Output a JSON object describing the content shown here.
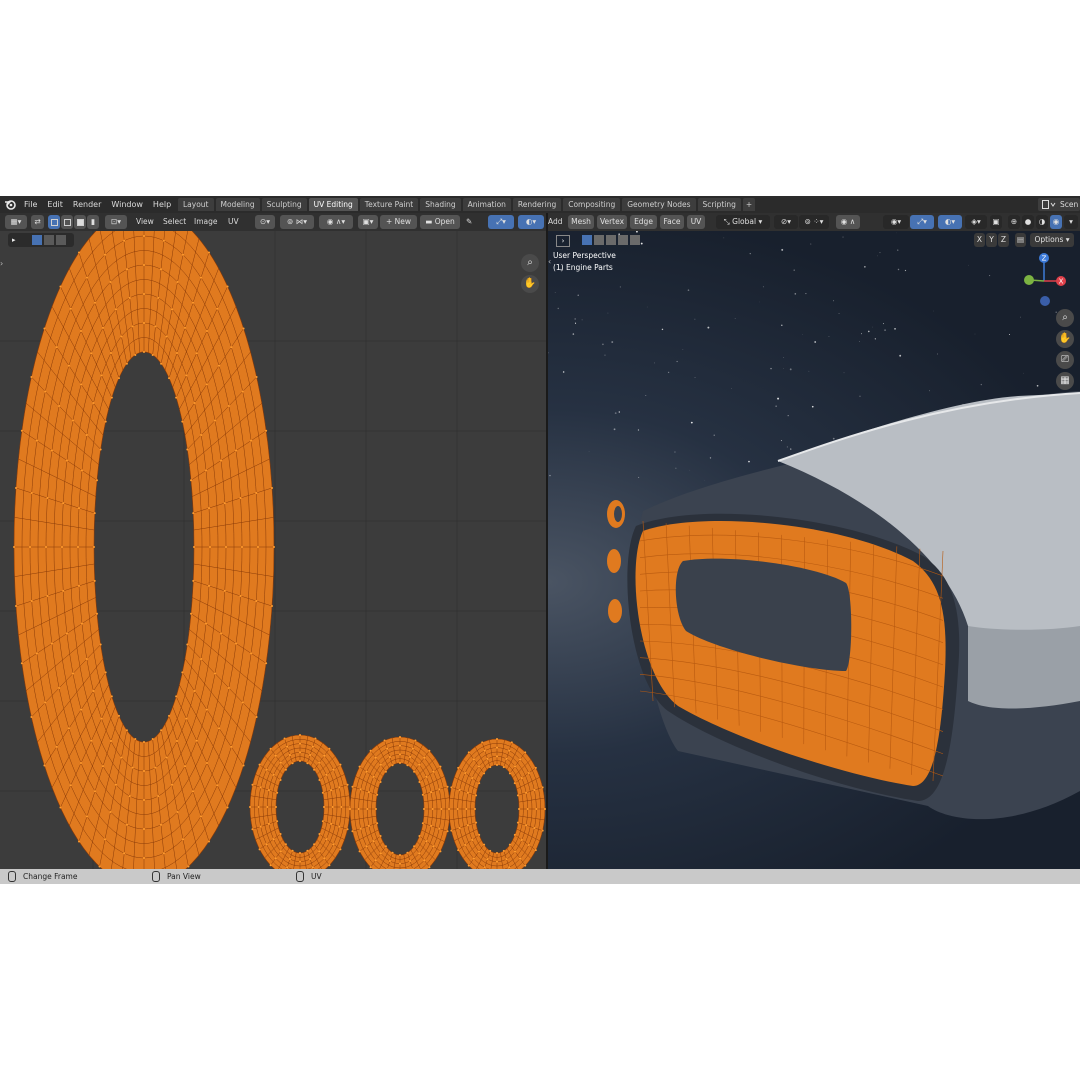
{
  "menubar": {
    "items": [
      "File",
      "Edit",
      "Render",
      "Window",
      "Help"
    ],
    "workspaces": [
      "Layout",
      "Modeling",
      "Sculpting",
      "UV Editing",
      "Texture Paint",
      "Shading",
      "Animation",
      "Rendering",
      "Compositing",
      "Geometry Nodes",
      "Scripting"
    ],
    "active_workspace": "UV Editing",
    "add_tab": "+",
    "scene_label": "Scen"
  },
  "uv_editor": {
    "menus": [
      "View",
      "Select",
      "Image",
      "UV"
    ],
    "new_label": "New",
    "open_label": "Open"
  },
  "viewport": {
    "menus": [
      "Add",
      "Mesh",
      "Vertex",
      "Edge",
      "Face",
      "UV"
    ],
    "transform_orientation": "Global",
    "axes": [
      "X",
      "Y",
      "Z"
    ],
    "options_label": "Options",
    "overlay_line1": "User Perspective",
    "overlay_line2": "(1) Engine Parts",
    "gizmo": {
      "z": "Z",
      "x": "X"
    }
  },
  "statusbar": {
    "items": [
      "Change Frame",
      "Pan View",
      "UV"
    ]
  },
  "colors": {
    "uv_face": "#e07a1f",
    "uv_edge": "#8a3a08",
    "uv_vertex": "#ff9b2e",
    "active_tab": "#545454",
    "header": "#303030",
    "uv_background": "#3c3c3c",
    "space_background": "#1f2937"
  }
}
